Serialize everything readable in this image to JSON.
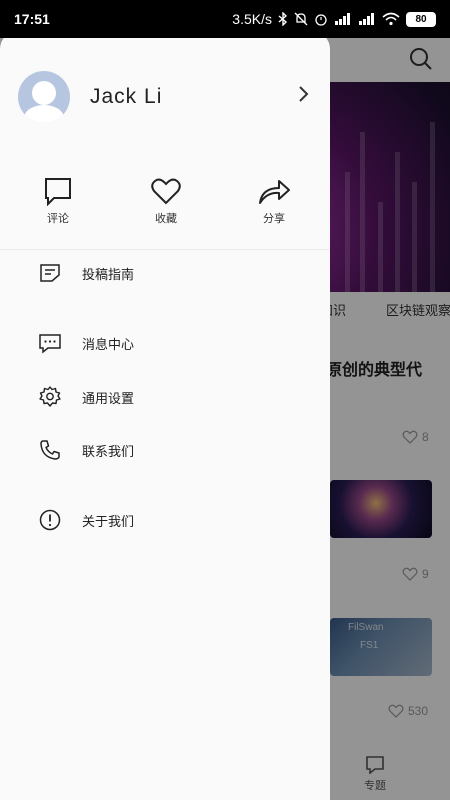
{
  "status_bar": {
    "time": "17:51",
    "network_speed": "3.5K/s",
    "battery": "80"
  },
  "drawer": {
    "username": "Jack Li",
    "actions": [
      {
        "label": "评论",
        "icon": "comment-icon"
      },
      {
        "label": "收藏",
        "icon": "heart-icon"
      },
      {
        "label": "分享",
        "icon": "share-icon"
      }
    ],
    "menu": [
      {
        "label": "投稿指南",
        "icon": "document-edit-icon"
      },
      {
        "label": "消息中心",
        "icon": "message-icon"
      },
      {
        "label": "通用设置",
        "icon": "settings-icon"
      },
      {
        "label": "联系我们",
        "icon": "phone-icon"
      },
      {
        "label": "关于我们",
        "icon": "info-icon"
      }
    ]
  },
  "background": {
    "tabs": [
      "知识",
      "区块链观察"
    ],
    "article_title": "原创的典型代",
    "likes": [
      "8",
      "9",
      "530"
    ],
    "thumb_text": [
      "FilSwan",
      "FS1"
    ],
    "bottom_tab": "专题"
  }
}
